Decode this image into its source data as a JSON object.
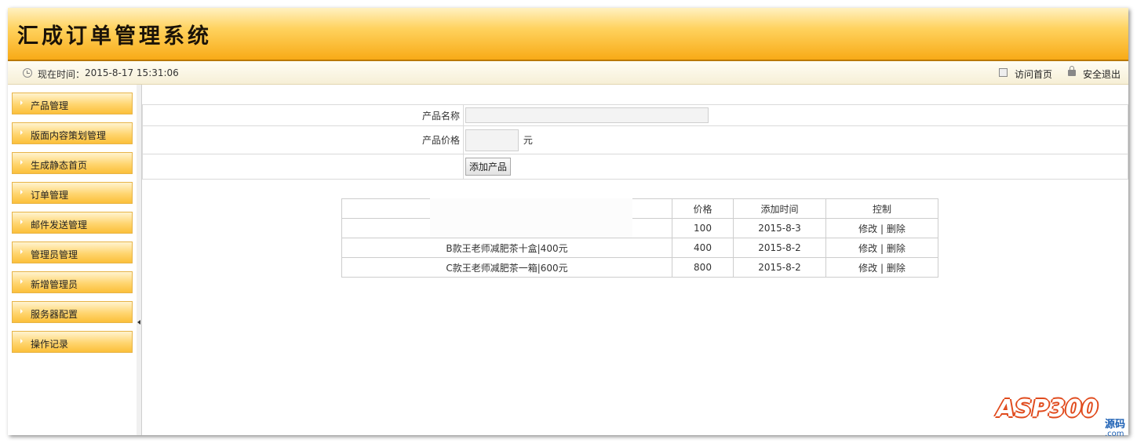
{
  "app": {
    "title": "汇成订单管理系统"
  },
  "status_bar": {
    "time_label": "现在时间：",
    "time_value": "2015-8-17 15:31:06",
    "home_link": "访问首页",
    "logout_link": "安全退出"
  },
  "sidebar": {
    "items": [
      {
        "label": "产品管理"
      },
      {
        "label": "版面内容策划管理"
      },
      {
        "label": "生成静态首页"
      },
      {
        "label": "订单管理"
      },
      {
        "label": "邮件发送管理"
      },
      {
        "label": "管理员管理"
      },
      {
        "label": "新增管理员"
      },
      {
        "label": "服务器配置"
      },
      {
        "label": "操作记录"
      }
    ]
  },
  "form": {
    "name_label": "产品名称",
    "name_value": "",
    "price_label": "产品价格",
    "price_value": "",
    "price_unit": "元",
    "submit_label": "添加产品"
  },
  "product_table": {
    "headers": [
      "",
      "价格",
      "添加时间",
      "控制"
    ],
    "rows": [
      {
        "name": "",
        "price": "100",
        "date": "2015-8-3",
        "edit": "修改",
        "sep": "|",
        "delete": "删除"
      },
      {
        "name": "B款王老师减肥茶十盒|400元",
        "price": "400",
        "date": "2015-8-2",
        "edit": "修改",
        "sep": "|",
        "delete": "删除"
      },
      {
        "name": "C款王老师减肥茶一箱|600元",
        "price": "800",
        "date": "2015-8-2",
        "edit": "修改",
        "sep": "|",
        "delete": "删除"
      }
    ]
  },
  "watermark": {
    "brand": "ASP300",
    "cn": "源码",
    "domain": ".com"
  },
  "colors": {
    "header_top": "#fff1c2",
    "header_bottom": "#f8ab17",
    "menu_border": "#e7b447"
  },
  "icons": [
    "clock-icon",
    "home-icon",
    "lock-icon",
    "menu-arrow-icon",
    "collapse-arrow-icon"
  ]
}
